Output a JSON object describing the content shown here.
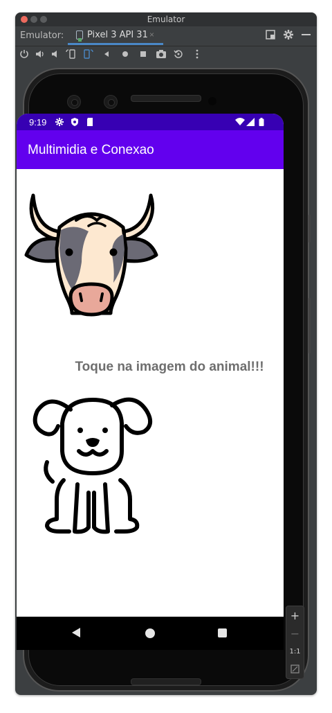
{
  "window": {
    "title": "Emulator"
  },
  "tool_window": {
    "label": "Emulator:",
    "tab_label": "Pixel 3 API 31",
    "tab_close": "×"
  },
  "toolbar": {
    "icons": [
      "power-icon",
      "volume-up-icon",
      "volume-down-icon",
      "rotate-left-icon",
      "rotate-right-icon",
      "back-icon",
      "home-icon",
      "overview-icon",
      "screenshot-icon",
      "snapshot-icon",
      "more-icon"
    ]
  },
  "status_bar": {
    "time": "9:19",
    "icons": [
      "settings-icon",
      "shield-icon",
      "sd-card-icon",
      "wifi-icon",
      "signal-icon",
      "battery-icon"
    ]
  },
  "app_bar": {
    "title": "Multimidia e Conexao"
  },
  "content": {
    "hint_text": "Toque na imagem do animal!!!",
    "images": [
      "cow-image",
      "dog-image"
    ]
  },
  "zoom_panel": {
    "zoom_in": "+",
    "zoom_out": "−",
    "actual_size": "1:1"
  },
  "colors": {
    "status_bar": "#3700b3",
    "app_bar": "#6200ee",
    "hint_text": "#6e6e6e",
    "cow_face": "#fde8d0",
    "cow_patch": "#6b6a75",
    "cow_nose": "#e8a89a"
  }
}
